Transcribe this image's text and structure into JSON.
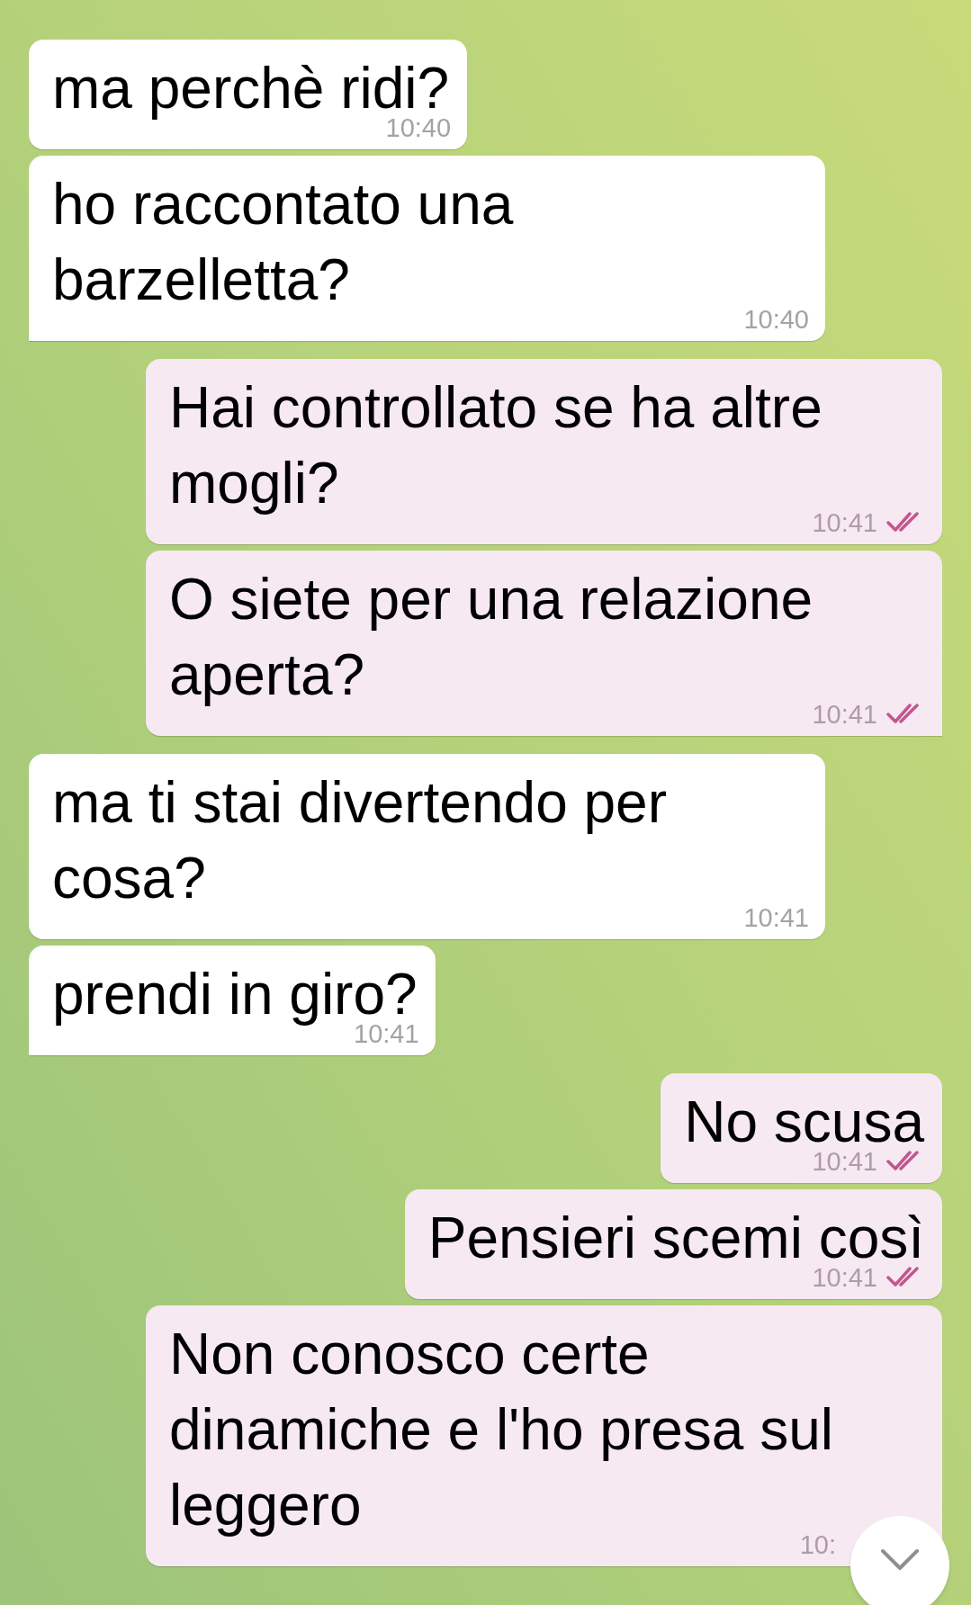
{
  "messages": [
    {
      "kind": "incoming",
      "text": "ma perchè ridi?",
      "time": "10:40",
      "tail": false
    },
    {
      "kind": "incoming",
      "text": "ho raccontato una barzelletta?",
      "time": "10:40",
      "tail": true
    },
    {
      "kind": "outgoing",
      "text": "Hai controllato se ha altre mogli?",
      "time": "10:41",
      "read": true,
      "tail": false
    },
    {
      "kind": "outgoing",
      "text": "O siete per una relazione aperta?",
      "time": "10:41",
      "read": true,
      "tail": true
    },
    {
      "kind": "incoming",
      "text": "ma ti stai divertendo per cosa?",
      "time": "10:41",
      "tail": false
    },
    {
      "kind": "incoming",
      "text": "prendi in giro?",
      "time": "10:41",
      "tail": true
    },
    {
      "kind": "outgoing",
      "text": "No scusa",
      "time": "10:41",
      "read": true,
      "tail": false
    },
    {
      "kind": "outgoing",
      "text": "Pensieri scemi così",
      "time": "10:41",
      "read": true,
      "tail": false
    },
    {
      "kind": "outgoing",
      "text": "Non conosco certe dinamiche e l'ho presa sul leggero",
      "time": "10:"
    }
  ],
  "scroll_down_button": true
}
